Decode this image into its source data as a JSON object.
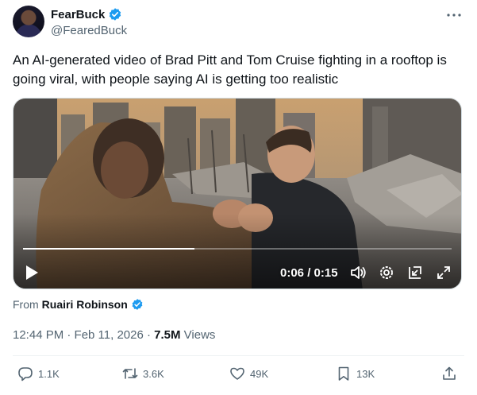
{
  "author": {
    "display_name": "FearBuck",
    "handle": "@FearedBuck",
    "verified": true,
    "avatar": "avatar"
  },
  "tweet": {
    "text": "An AI-generated video of Brad Pitt and Tom Cruise fighting in a rooftop is going viral, with people saying AI is getting too realistic"
  },
  "video": {
    "time_display": "0:06 / 0:15",
    "progress": 0.4,
    "controls": [
      "play-icon",
      "volume-icon",
      "settings-icon",
      "pip-icon",
      "fullscreen-icon"
    ]
  },
  "source": {
    "prefix": "From",
    "name": "Ruairi Robinson",
    "verified": true
  },
  "meta": {
    "time_date": "12:44 PM · Feb 11, 2026 · ",
    "views_count": "7.5M",
    "views_label": " Views"
  },
  "actions": {
    "replies": "1.1K",
    "reposts": "3.6K",
    "likes": "49K",
    "bookmarks": "13K"
  },
  "colors": {
    "verified_blue": "#1d9bf0",
    "text_primary": "#0f1419",
    "text_secondary": "#536471"
  }
}
